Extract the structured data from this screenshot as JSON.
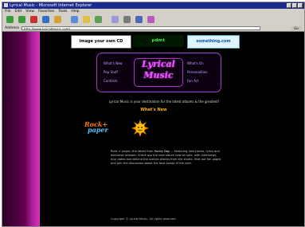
{
  "window": {
    "title": "Lyrical Music - Microsoft Internet Explorer"
  },
  "menu": [
    "File",
    "Edit",
    "View",
    "Favorites",
    "Tools",
    "Help"
  ],
  "address": {
    "label": "Address",
    "url": "http://www.lyricalmusic.com/",
    "go_label": "Go"
  },
  "banners": {
    "ad1": "image your own CD",
    "ad2": "pdmt",
    "ad3": "something.com"
  },
  "site": {
    "logo_line1": "Lyrical",
    "logo_line2": "Music",
    "nav_left": [
      "What's New",
      "Pop Stuff",
      "Contests"
    ],
    "nav_right": [
      "What's On",
      "Personalities",
      "Fan Art"
    ],
    "tagline": "Lyrical Music is your destination for the latest albums & the greatest!",
    "whats_new": "What's New",
    "feature_word1": "Rock+",
    "feature_word2": "paper",
    "para_lead": "Rock n' paper: the latest from ",
    "para_hl": "Sunny Day",
    "para_rest": " — featuring new tracks, lyrics and exclusive artwork. Check out the new album now on sale, with interviews, tour dates and behind the scenes photos from the studio. Visit our fan pages and join the discussion about the best songs of the year.",
    "footer": "Copyright © Lyrical Music. All rights reserved."
  },
  "colors": {
    "page_bg": "#000000",
    "accent_magenta": "#d238b8",
    "whats_new": "#ffb000"
  }
}
